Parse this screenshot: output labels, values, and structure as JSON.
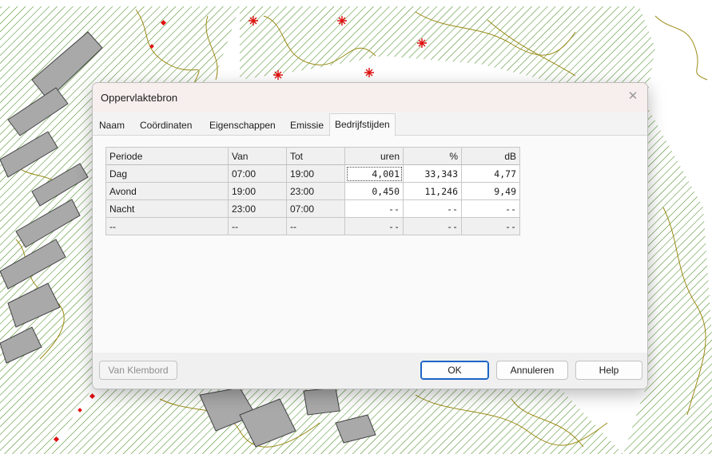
{
  "dialog": {
    "title": "Oppervlaktebron",
    "close_symbol": "✕",
    "tabs": [
      {
        "label": "Naam",
        "active": false
      },
      {
        "label": "Coördinaten",
        "active": false
      },
      {
        "label": "Eigenschappen",
        "active": false
      },
      {
        "label": "Emissie",
        "active": false
      },
      {
        "label": "Bedrijfstijden",
        "active": true
      }
    ],
    "table": {
      "headers": [
        "Periode",
        "Van",
        "Tot",
        "uren",
        "%",
        "dB"
      ],
      "rows": [
        [
          "Dag",
          "07:00",
          "19:00",
          "4,001",
          "33,343",
          "4,77"
        ],
        [
          "Avond",
          "19:00",
          "23:00",
          "0,450",
          "11,246",
          "9,49"
        ],
        [
          "Nacht",
          "23:00",
          "07:00",
          "--",
          "--",
          "--"
        ],
        [
          "--",
          "--",
          "--",
          "--",
          "--",
          "--"
        ]
      ],
      "selected_cell": "4,001"
    },
    "buttons": {
      "clipboard": "Van Klembord",
      "ok": "OK",
      "cancel": "Annuleren",
      "help": "Help"
    }
  },
  "colors": {
    "map_hatch": "#4a8c22",
    "map_contour": "#9a8a14",
    "building_fill": "#a9a9a9",
    "marker_red": "#e01010",
    "default_button_border": "#1c64c4"
  }
}
